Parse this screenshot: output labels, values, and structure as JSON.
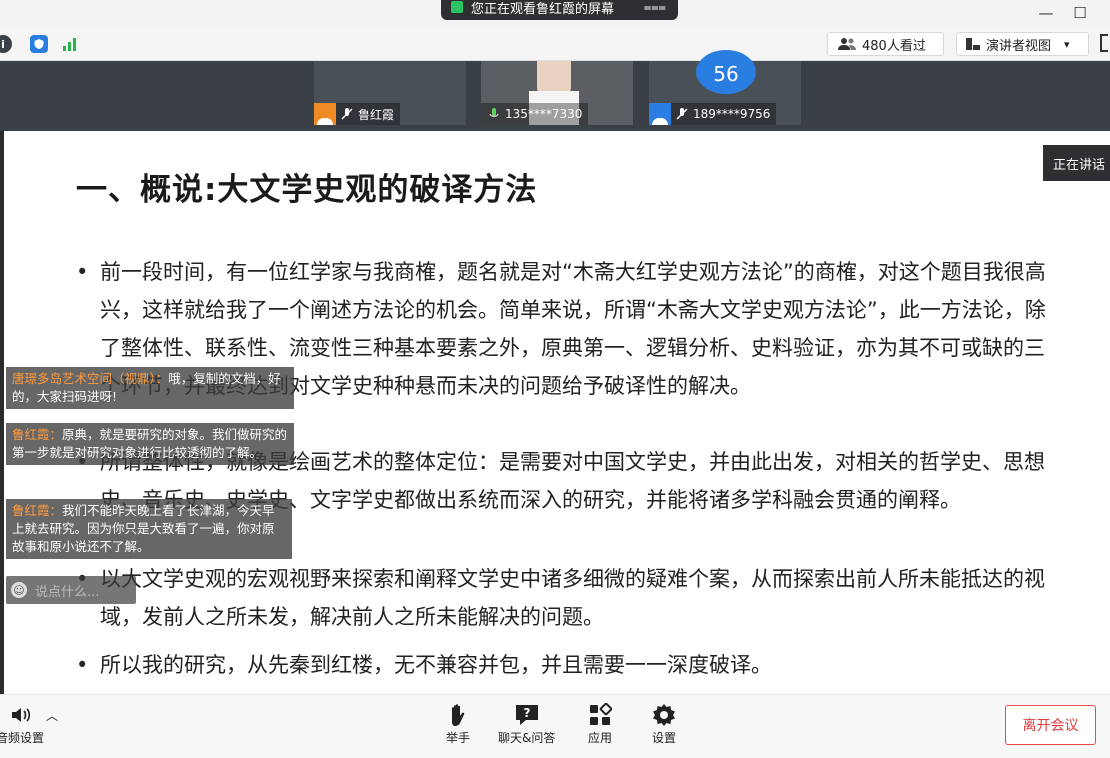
{
  "title_bar": {
    "share_banner": "您正在观看鲁红霞的屏幕",
    "banner_menu_icon": "menu-icon",
    "minimize_glyph": "—",
    "maximize_glyph": "☐"
  },
  "toolbar": {
    "viewer_count": "480人看过",
    "presenter_view": "演讲者视图",
    "presenter_view_caret": "▾"
  },
  "video_tiles": [
    {
      "name": "鲁红霞",
      "avatar_color": "#f08a24"
    },
    {
      "name": "135****7330"
    },
    {
      "name": "189****9756",
      "avatar_color": "#2a7de1"
    }
  ],
  "participant_badge": "56",
  "speaking_tag": "正在讲话",
  "slide": {
    "title": "一、概说:大文学史观的破译方法",
    "bullets": [
      "前一段时间，有一位红学家与我商榷，题名就是对“木斋大红学史观方法论”的商榷，对这个题目我很高兴，这样就给我了一个阐述方法论的机会。简单来说，所谓“木斋大文学史观方法论”，此一方法论，除了整体性、联系性、流变性三种基本要素之外，原典第一、逻辑分析、史料验证，亦为其不可或缺的三个环节，并最终达到对文学史种种悬而未决的问题给予破译性的解决。",
      "所谓整体性，就像是绘画艺术的整体定位：是需要对中国文学史，并由此出发，对相关的哲学史、思想史、音乐史、史学史、文字学史都做出系统而深入的研究，并能将诸多学科融会贯通的阐释。",
      "以大文学史观的宏观视野来探索和阐释文学史中诸多细微的疑难个案，从而探索出前人所未能抵达的视域，发前人之所未发，解决前人之所未能解决的问题。",
      "所以我的研究，从先秦到红楼，无不兼容并包，并且需要一一深度破译。"
    ]
  },
  "chat": [
    {
      "sender": "唐璟多岛艺术空间（视鼎）：",
      "text": "哦，复制的文档，好的，大家扫码进呀!"
    },
    {
      "sender": "鲁红霞：",
      "text": "原典，就是要研究的对象。我们做研究的第一步就是对研究对象进行比较透彻的了解。"
    },
    {
      "sender": "鲁红霞：",
      "text": "我们不能昨天晚上看了长津湖，今天早上就去研究。因为你只是大致看了一遍，你对原故事和原小说还不了解。"
    }
  ],
  "chat_input_placeholder": "说点什么...",
  "bottom_bar": {
    "audio_settings": "音频设置",
    "raise_hand": "举手",
    "chat_qa": "聊天&问答",
    "apps": "应用",
    "settings": "设置",
    "leave": "离开会议"
  },
  "colors": {
    "accent_blue": "#2a7de1",
    "leave_red": "#e23c3c",
    "chat_sender": "#ff9a3c"
  }
}
